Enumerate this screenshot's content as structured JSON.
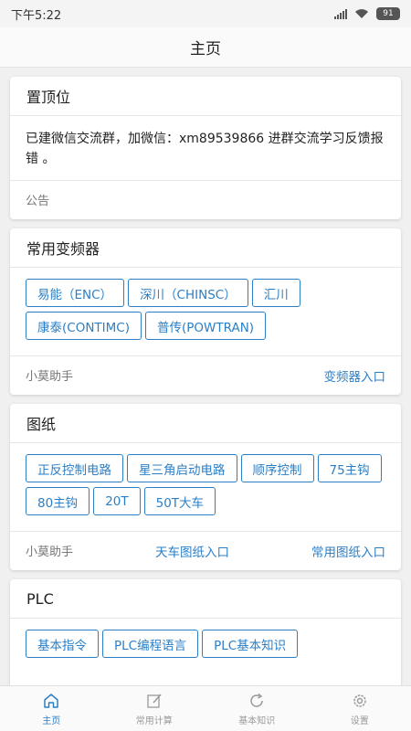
{
  "status_bar": {
    "time": "下午5:22",
    "battery": "91"
  },
  "nav": {
    "title": "主页"
  },
  "pinned": {
    "title": "置顶位",
    "text": "已建微信交流群，加微信：xm89539866 进群交流学习反馈报错 。",
    "footer_label": "公告"
  },
  "inverters": {
    "title": "常用变频器",
    "chips": [
      "易能（ENC）",
      "深川（CHINSC）",
      "汇川",
      "康泰(CONTIMC)",
      "普传(POWTRAN)"
    ],
    "footer_left": "小莫助手",
    "footer_link": "变频器入口"
  },
  "drawings": {
    "title": "图纸",
    "chips": [
      "正反控制电路",
      "星三角启动电路",
      "顺序控制",
      "75主钩",
      "80主钩",
      "20T",
      "50T大车"
    ],
    "footer_left": "小莫助手",
    "footer_link_1": "天车图纸入口",
    "footer_link_2": "常用图纸入口"
  },
  "plc": {
    "title": "PLC",
    "chips": [
      "基本指令",
      "PLC编程语言",
      "PLC基本知识"
    ]
  },
  "tabs": [
    {
      "label": "主页",
      "icon": "home-icon",
      "active": true
    },
    {
      "label": "常用计算",
      "icon": "edit-icon",
      "active": false
    },
    {
      "label": "基本知识",
      "icon": "refresh-icon",
      "active": false
    },
    {
      "label": "设置",
      "icon": "gear-icon",
      "active": false
    }
  ],
  "colors": {
    "accent": "#2b7fc6",
    "background": "#f0f0f0"
  }
}
